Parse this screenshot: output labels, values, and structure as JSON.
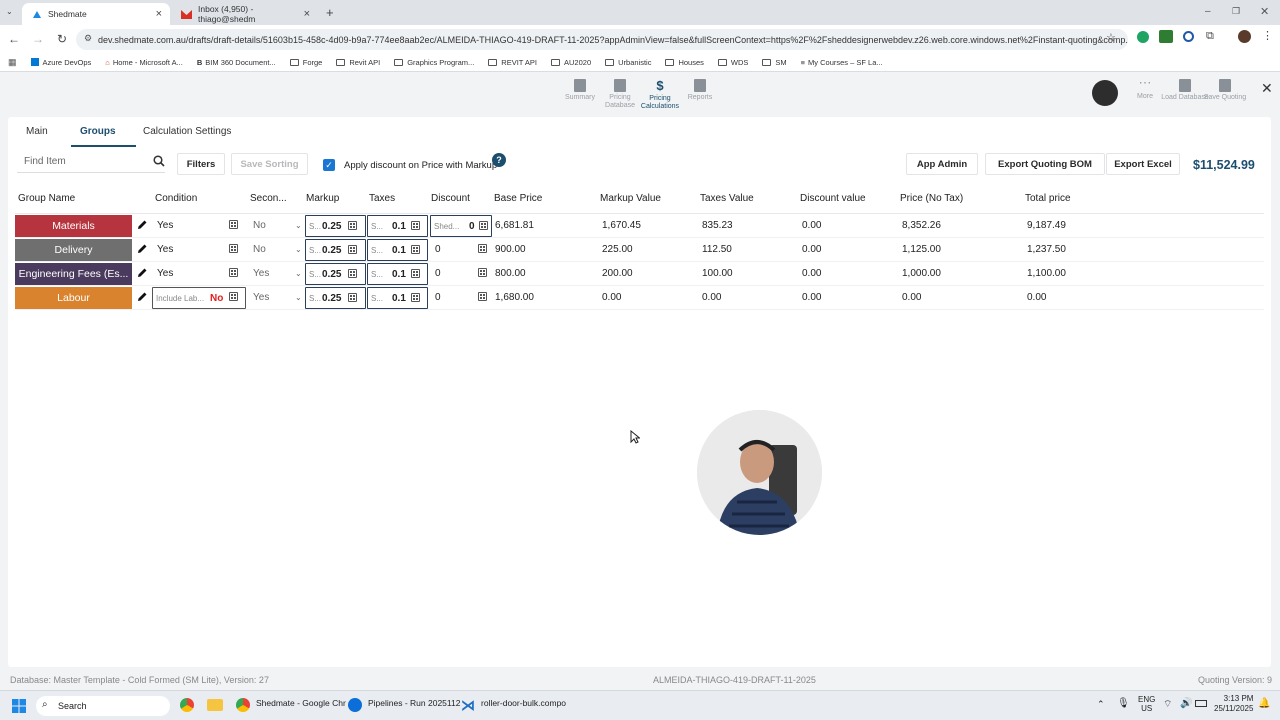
{
  "browser": {
    "tabs": [
      {
        "title": "Shedmate"
      },
      {
        "title": "Inbox (4,950) - thiago@shedm"
      }
    ],
    "url": "dev.shedmate.com.au/drafts/draft-details/51603b15-458c-4d09-b9a7-774ee8aab2ec/ALMEIDA-THIAGO-419-DRAFT-11-2025?appAdminView=false&fullScreenContext=https%2F%2Fsheddesignerwebdev.z26.web.core.windows.net%2Finstant-quoting&comp...",
    "bookmarks": [
      "Azure DevOps",
      "Home - Microsoft A...",
      "BIM 360 Document...",
      "Forge",
      "Revit API",
      "Graphics Program...",
      "REVIT API",
      "AU2020",
      "Urbanistic",
      "Houses",
      "WDS",
      "SM",
      "My Courses – SF La..."
    ]
  },
  "toolbar": {
    "summary": "Summary",
    "pricing_db": "Pricing Database",
    "pricing_calc": "Pricing Calculations",
    "reports": "Reports",
    "more": "More",
    "load_db": "Load Database",
    "save_quoting": "Save Quoting"
  },
  "tabs": {
    "main": "Main",
    "groups": "Groups",
    "calc_settings": "Calculation Settings"
  },
  "controls": {
    "search_placeholder": "Find Item",
    "filters": "Filters",
    "save_sorting": "Save Sorting",
    "apply_discount": "Apply discount on Price with Markup",
    "app_admin": "App Admin",
    "export_bom": "Export Quoting BOM",
    "export_excel": "Export Excel",
    "total": "$11,524.99"
  },
  "table": {
    "headers": [
      "Group Name",
      "Condition",
      "Secon...",
      "Markup",
      "Taxes",
      "Discount",
      "Base Price",
      "Markup Value",
      "Taxes Value",
      "Discount value",
      "Price (No Tax)",
      "Total price"
    ],
    "rows": [
      {
        "name": "Materials",
        "color": "#b5343d",
        "condition": "Yes",
        "secondary": "No",
        "markup_pre": "S...",
        "markup": "0.25",
        "taxes_pre": "S...",
        "taxes": "0.1",
        "discount_pre": "Shed...",
        "discount": "0",
        "base": "6,681.81",
        "markup_value": "1,670.45",
        "taxes_value": "835.23",
        "discount_value": "0.00",
        "price_no_tax": "8,352.26",
        "total": "9,187.49"
      },
      {
        "name": "Delivery",
        "color": "#6f6f6f",
        "condition": "Yes",
        "secondary": "No",
        "markup_pre": "S...",
        "markup": "0.25",
        "taxes_pre": "S...",
        "taxes": "0.1",
        "discount_pre": "",
        "discount": "0",
        "base": "900.00",
        "markup_value": "225.00",
        "taxes_value": "112.50",
        "discount_value": "0.00",
        "price_no_tax": "1,125.00",
        "total": "1,237.50"
      },
      {
        "name": "Engineering Fees (Es...",
        "color": "#4a3a5e",
        "condition": "Yes",
        "secondary": "Yes",
        "markup_pre": "S...",
        "markup": "0.25",
        "taxes_pre": "S...",
        "taxes": "0.1",
        "discount_pre": "",
        "discount": "0",
        "base": "800.00",
        "markup_value": "200.00",
        "taxes_value": "100.00",
        "discount_value": "0.00",
        "price_no_tax": "1,000.00",
        "total": "1,100.00"
      },
      {
        "name": "Labour",
        "color": "#d9832e",
        "condition_pre": "Include Lab...",
        "condition": "No",
        "secondary": "Yes",
        "markup_pre": "S...",
        "markup": "0.25",
        "taxes_pre": "S...",
        "taxes": "0.1",
        "discount_pre": "",
        "discount": "0",
        "base": "1,680.00",
        "markup_value": "0.00",
        "taxes_value": "0.00",
        "discount_value": "0.00",
        "price_no_tax": "0.00",
        "total": "0.00"
      }
    ]
  },
  "footer": {
    "database": "Database: Master Template - Cold Formed (SM Lite), Version: 27",
    "draft": "ALMEIDA-THIAGO-419-DRAFT-11-2025",
    "version": "Quoting Version: 9"
  },
  "taskbar": {
    "search": "Search",
    "apps": [
      "Shedmate - Google Chr",
      "Pipelines - Run 2025112",
      "roller-door-bulk.compo"
    ],
    "lang": "ENG",
    "region": "US",
    "time": "3:13 PM",
    "date": "25/11/2025"
  }
}
